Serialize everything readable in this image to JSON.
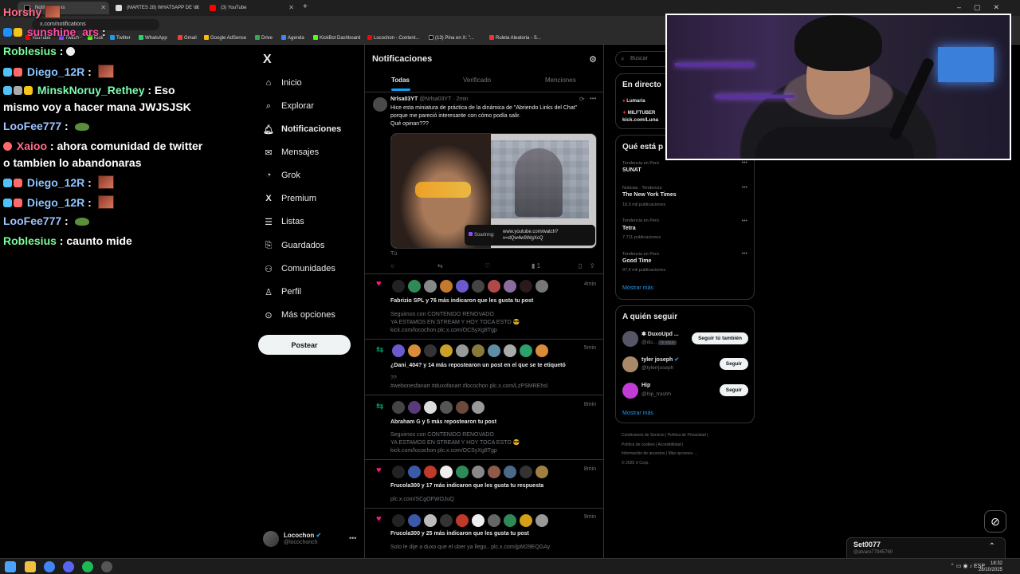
{
  "browser": {
    "tabs": [
      {
        "label": "Notificaciones",
        "active": true
      },
      {
        "label": "(MARTES 28) WHATSAPP DE VI",
        "active": false
      },
      {
        "label": "(3) YouTube",
        "active": false
      }
    ],
    "url": "x.com/notifications",
    "bookmarks": [
      "YouTube",
      "Twitch",
      "Kick",
      "Twitter",
      "WhatsApp",
      "Gmail",
      "Google AdSense",
      "Drive",
      "Agenda",
      "KickBot Dashboard",
      "Locochon - Content...",
      "(13) Pina en X: \"...",
      "Ruleta Aleatoria - S..."
    ]
  },
  "chat": [
    {
      "user": "Horshy",
      "color": "#ff6b8a",
      "text": ""
    },
    {
      "user": "sunshine_ars",
      "color": "#ff4da6",
      "text": ""
    },
    {
      "user": "Roblesius",
      "color": "#7cfc9a",
      "text": ""
    },
    {
      "user": "Diego_12R",
      "color": "#8ec5ff",
      "text": ""
    },
    {
      "user": "MinskNoruy_Rethey",
      "color": "#7cfcb0",
      "text": ": Eso"
    },
    {
      "user": "",
      "color": "#fff",
      "text": "mismo voy a hacer mana JWJSJSK"
    },
    {
      "user": "LooFee777",
      "color": "#9fc3ff",
      "text": ""
    },
    {
      "user": "Xaioo",
      "color": "#ff6b8a",
      "text": ": ahora comunidad de twitter"
    },
    {
      "user": "",
      "color": "#fff",
      "text": "o tambien lo abandonaras"
    },
    {
      "user": "Diego_12R",
      "color": "#8ec5ff",
      "text": ""
    },
    {
      "user": "Diego_12R",
      "color": "#8ec5ff",
      "text": ""
    },
    {
      "user": "LooFee777",
      "color": "#9fc3ff",
      "text": ""
    },
    {
      "user": "Roblesius",
      "color": "#7cfc9a",
      "text": ": caunto mide"
    }
  ],
  "nav": {
    "logo": "X",
    "items": [
      "Inicio",
      "Explorar",
      "Notificaciones",
      "Mensajes",
      "Grok",
      "Premium",
      "Listas",
      "Guardados",
      "Comunidades",
      "Perfil",
      "Más opciones"
    ],
    "post": "Postear",
    "me_name": "Locochon",
    "me_handle": "@locochonch"
  },
  "main": {
    "title": "Notificaciones",
    "tabs": [
      "Todas",
      "Verificado",
      "Menciones"
    ],
    "tweet": {
      "name": "Nrlsa03YT",
      "handle": "@Nrlsa03YT",
      "time": "2min",
      "text1": "Hice esta miniatura de práctica de la dinámica de \"Abriendo Links del Chat\"",
      "text2": "porque me pareció interesante con cómo podía salir.",
      "text3": "Qué opinan???",
      "media_label": "Soarinng:",
      "media_url1": "www.youtube.com/watch?",
      "media_url2": "v=dQw4w9WgXcQ",
      "tu": "Tú",
      "views": "1"
    },
    "notifs": [
      {
        "time": "4min",
        "title": "Fabrizio SPL y 76 más indicaron que les gusta tu post",
        "l1": "Seguimos con CONTENIDO RENOVADO",
        "l2": "YA ESTAMOS EN STREAM Y HOY TOCA ESTO 😎",
        "l3": "kick.com/locochon plc.x.com/OCSyXg8Tgp"
      },
      {
        "time": "5min",
        "title": "¿Dani_404? y 14 más repostearon un post en el que se te etiquetó",
        "l1": "??",
        "l2": "#webonesfanart #duxofanart #locochon plc.x.com/LzPSMREhsl",
        "l3": ""
      },
      {
        "time": "8min",
        "title": "Abraham G y 5 más repostearon tu post",
        "l1": "Seguimos con CONTENIDO RENOVADO",
        "l2": "YA ESTAMOS EN STREAM Y HOY TOCA ESTO 😎",
        "l3": "kick.com/locochon plc.x.com/OCSyXg8Tgp"
      },
      {
        "time": "8min",
        "title": "Frucola300 y 17 más indicaron que les gusta tu respuesta",
        "l1": "plc.x.com/SCgOFWOJuQ",
        "l2": "",
        "l3": ""
      },
      {
        "time": "9min",
        "title": "Frucola300 y 25 más indicaron que les gusta tu post",
        "l1": "Solo le dije a duxo que el uber ya llego.. plc.x.com/jpM29EQGAy",
        "l2": "",
        "l3": ""
      }
    ]
  },
  "right": {
    "search": "Buscar",
    "live_title": "En directo",
    "live_user": "Lumaria",
    "live_text": "MILFTUBER",
    "live_url": "kick.com/Luna",
    "trends_title": "Qué está p",
    "trends": [
      {
        "cat": "Tendencia en Perú",
        "name": "SUNAT",
        "count": ""
      },
      {
        "cat": "Noticias · Tendencia",
        "name": "The New York Times",
        "count": "18,5 mil publicaciones"
      },
      {
        "cat": "Tendencia en Perú",
        "name": "Tetra",
        "count": "7.711 publicaciones"
      },
      {
        "cat": "Tendencia en Perú",
        "name": "Good Time",
        "count": "97,4 mil publicaciones"
      }
    ],
    "more": "Mostrar más",
    "who_title": "A quién seguir",
    "who": [
      {
        "name": "✱ DuxoUpd ...",
        "handle": "@du...",
        "tag": "Te sigue",
        "btn": "Seguir tú también"
      },
      {
        "name": "tyler joseph",
        "handle": "@tylerrjoseph",
        "tag": "",
        "btn": "Seguir"
      },
      {
        "name": "Hip",
        "handle": "@hip_trashh",
        "tag": "",
        "btn": "Seguir"
      }
    ],
    "footer": [
      "Condiciones de Servicio",
      "Política de Privacidad",
      "Política de cookies",
      "Accesibilidad",
      "Información de anuncios",
      "Más opciones ...",
      "© 2025 X Corp."
    ]
  },
  "messages_bar": {
    "name": "Set0077",
    "handle": "@alvaro77945760"
  },
  "taskbar": {
    "lang": "ESP",
    "time": "18:32",
    "date": "28/10/2025"
  }
}
